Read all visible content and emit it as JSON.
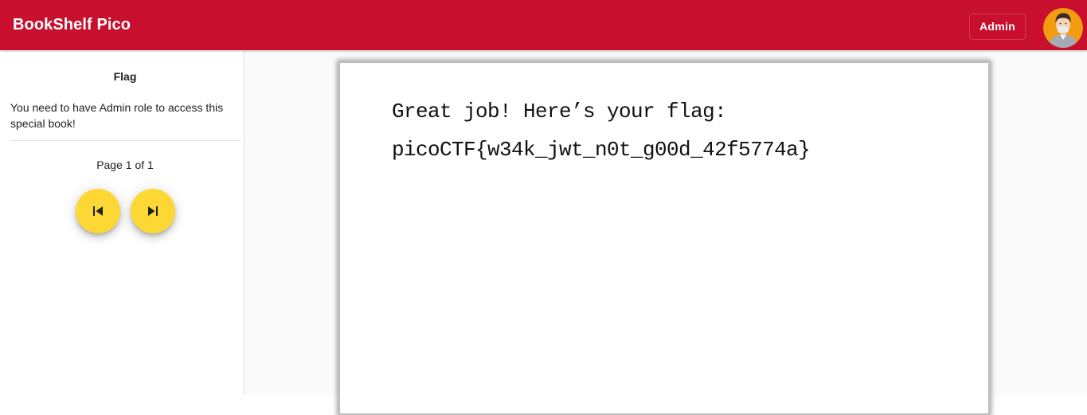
{
  "app": {
    "title": "BookShelf Pico",
    "brand_color": "#c8102e"
  },
  "header": {
    "admin_label": "Admin",
    "avatar_icon": "user-avatar-icon"
  },
  "sidebar": {
    "title": "Flag",
    "description": "You need to have Admin role to access this special book!",
    "page_indicator": "Page 1 of 1",
    "prev_icon": "skip-previous-icon",
    "next_icon": "skip-next-icon",
    "button_color": "#fdd835"
  },
  "book": {
    "line1": "Great job! Here’s your flag:",
    "line2": "picoCTF{w34k_jwt_n0t_g00d_42f5774a}"
  }
}
